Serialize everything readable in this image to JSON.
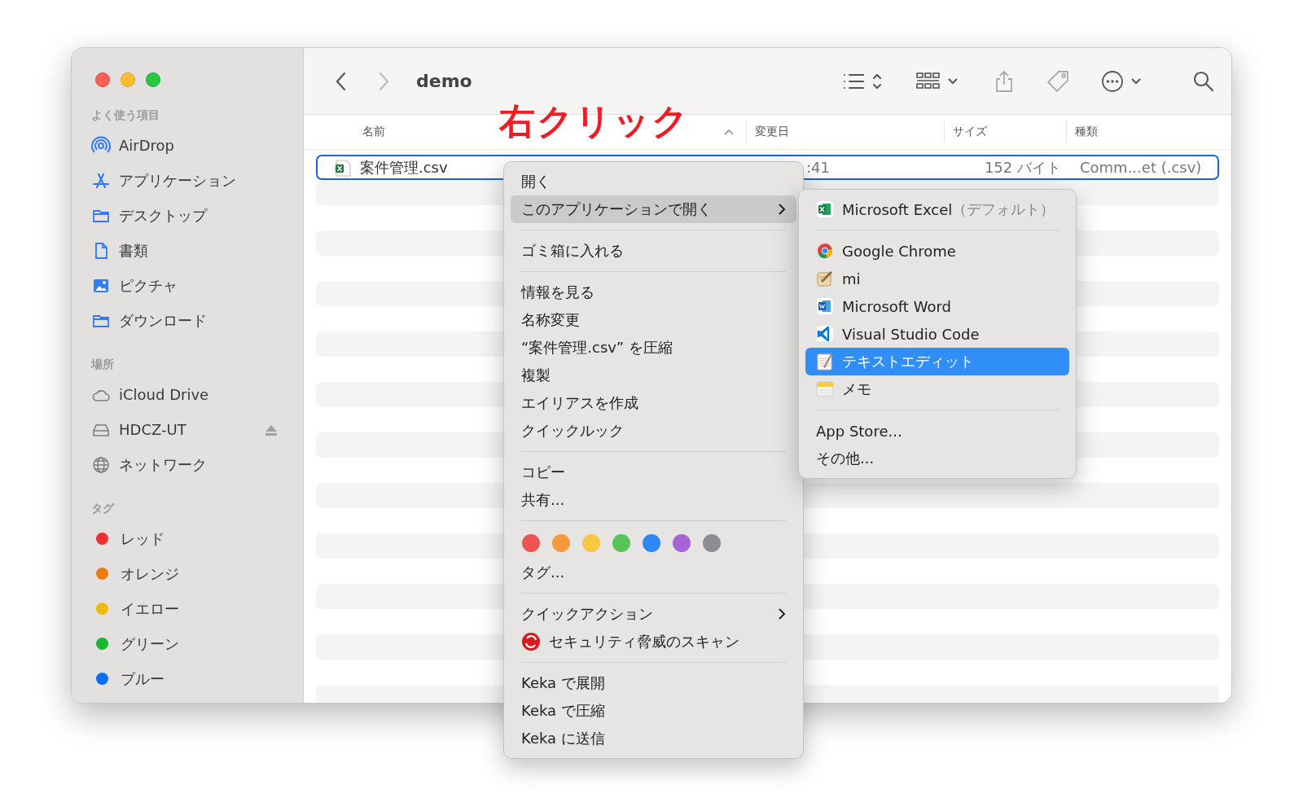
{
  "window": {
    "title": "demo",
    "back_enabled": true,
    "forward_enabled": false
  },
  "annotation": {
    "text": "右クリック"
  },
  "sidebar": {
    "sections": [
      {
        "title": "よく使う項目",
        "items": [
          {
            "kind": "airdrop",
            "label": "AirDrop"
          },
          {
            "kind": "apps",
            "label": "アプリケーション"
          },
          {
            "kind": "folder",
            "label": "デスクトップ"
          },
          {
            "kind": "document",
            "label": "書類"
          },
          {
            "kind": "picture",
            "label": "ピクチャ"
          },
          {
            "kind": "folder",
            "label": "ダウンロード"
          }
        ]
      },
      {
        "title": "場所",
        "items": [
          {
            "kind": "cloud",
            "label": "iCloud Drive"
          },
          {
            "kind": "drive",
            "label": "HDCZ-UT",
            "eject": true
          },
          {
            "kind": "network",
            "label": "ネットワーク"
          }
        ]
      },
      {
        "title": "タグ",
        "items": [
          {
            "kind": "tag",
            "label": "レッド",
            "color": "#f0302c"
          },
          {
            "kind": "tag",
            "label": "オレンジ",
            "color": "#ee7b10"
          },
          {
            "kind": "tag",
            "label": "イエロー",
            "color": "#f2b80c"
          },
          {
            "kind": "tag",
            "label": "グリーン",
            "color": "#18b830"
          },
          {
            "kind": "tag",
            "label": "ブルー",
            "color": "#0a6cf5"
          }
        ]
      }
    ]
  },
  "columns": [
    {
      "label": "名前",
      "sorted": true
    },
    {
      "label": "変更日",
      "sorted": false
    },
    {
      "label": "サイズ",
      "sorted": false
    },
    {
      "label": "種類",
      "sorted": false
    }
  ],
  "files": [
    {
      "name": "案件管理.csv",
      "modified": ":41",
      "size": "152 バイト",
      "file_type": "Comm...et (.csv)",
      "selected": true
    }
  ],
  "context_menu": {
    "items": [
      {
        "kind": "item",
        "label": "開く",
        "selected": false
      },
      {
        "kind": "submenu",
        "label": "このアプリケーションで開く",
        "selected": true
      },
      {
        "kind": "separator"
      },
      {
        "kind": "item",
        "label": "ゴミ箱に入れる",
        "selected": false
      },
      {
        "kind": "separator"
      },
      {
        "kind": "item",
        "label": "情報を見る",
        "selected": false
      },
      {
        "kind": "item",
        "label": "名称変更",
        "selected": false
      },
      {
        "kind": "item",
        "label": "“案件管理.csv” を圧縮",
        "selected": false
      },
      {
        "kind": "item",
        "label": "複製",
        "selected": false
      },
      {
        "kind": "item",
        "label": "エイリアスを作成",
        "selected": false
      },
      {
        "kind": "item",
        "label": "クイックルック",
        "selected": false
      },
      {
        "kind": "separator"
      },
      {
        "kind": "item",
        "label": "コピー",
        "selected": false
      },
      {
        "kind": "item",
        "label": "共有...",
        "selected": false
      },
      {
        "kind": "separator"
      },
      {
        "kind": "tags",
        "tags": [
          {
            "color": "#ee5450"
          },
          {
            "color": "#f59a3e"
          },
          {
            "color": "#f6c844"
          },
          {
            "color": "#55c557"
          },
          {
            "color": "#2f86f6"
          },
          {
            "color": "#a663d6"
          },
          {
            "color": "#8e8e92"
          }
        ]
      },
      {
        "kind": "item",
        "label": "タグ...",
        "selected": false
      },
      {
        "kind": "separator"
      },
      {
        "kind": "submenu",
        "label": "クイックアクション",
        "selected": false
      },
      {
        "kind": "icon-item",
        "label": "セキュリティ脅威のスキャン",
        "selected": false
      },
      {
        "kind": "separator"
      },
      {
        "kind": "item",
        "label": "Keka で展開",
        "selected": false
      },
      {
        "kind": "item",
        "label": "Keka で圧縮",
        "selected": false
      },
      {
        "kind": "item",
        "label": "Keka に送信",
        "selected": false
      }
    ]
  },
  "submenu": {
    "items": [
      {
        "kind": "spreadsheet",
        "label": "Microsoft Excel",
        "note": "（デフォルト）",
        "selected": false
      },
      {
        "kind": "separator"
      },
      {
        "kind": "browser",
        "label": "Google Chrome",
        "selected": false
      },
      {
        "kind": "pen",
        "label": "mi",
        "selected": false
      },
      {
        "kind": "wordprocessor",
        "label": "Microsoft Word",
        "selected": false
      },
      {
        "kind": "code",
        "label": "Visual Studio Code",
        "selected": false
      },
      {
        "kind": "texteditor",
        "label": "テキストエディット",
        "selected": true
      },
      {
        "kind": "notepad",
        "label": "メモ",
        "selected": false
      },
      {
        "kind": "separator"
      },
      {
        "kind": "item",
        "label": "App Store...",
        "selected": false
      },
      {
        "kind": "item",
        "label": "その他...",
        "selected": false
      }
    ]
  }
}
